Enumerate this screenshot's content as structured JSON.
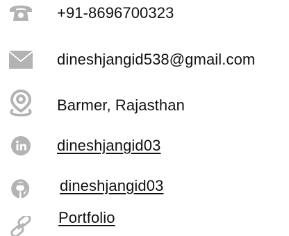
{
  "icon_color": "#b3b3b3",
  "contact": {
    "phone": {
      "icon": "phone-icon",
      "text": "+91-8696700323"
    },
    "email": {
      "icon": "envelope-icon",
      "text": "dineshjangid538@gmail.com"
    },
    "location": {
      "icon": "map-pin-icon",
      "text": "Barmer, Rajasthan"
    },
    "linkedin": {
      "icon": "linkedin-icon",
      "text": "dineshjangid03"
    },
    "github": {
      "icon": "github-icon",
      "text": "dineshjangid03"
    },
    "portfolio": {
      "icon": "link-icon",
      "text": "Portfolio"
    }
  }
}
